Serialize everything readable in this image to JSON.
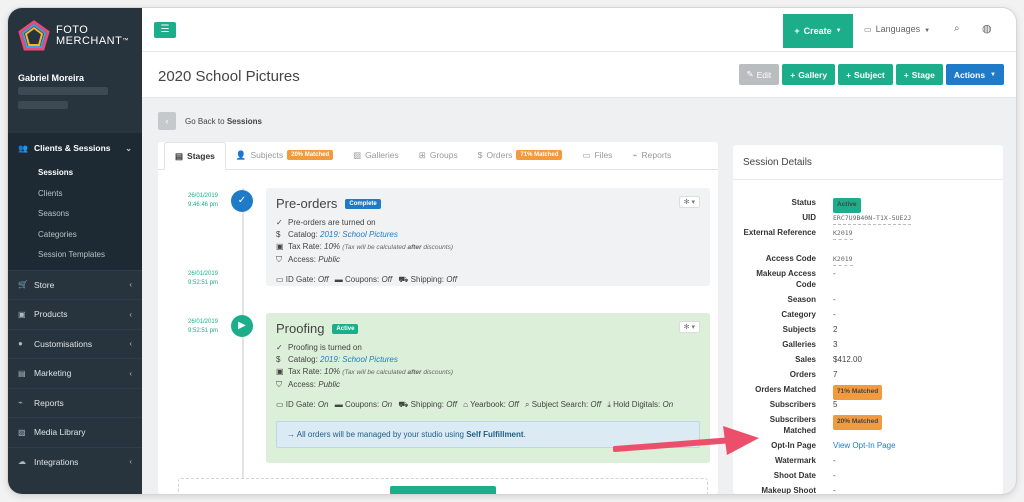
{
  "brand": {
    "name_line1": "FOTO",
    "name_line2": "MERCHANT",
    "trademark": "™"
  },
  "user": {
    "name": "Gabriel Moreira"
  },
  "sidebar": {
    "group": {
      "label": "Clients & Sessions"
    },
    "subitems": [
      {
        "label": "Sessions"
      },
      {
        "label": "Clients"
      },
      {
        "label": "Seasons"
      },
      {
        "label": "Categories"
      },
      {
        "label": "Session Templates"
      }
    ],
    "items": [
      {
        "label": "Store",
        "icon": "cart-icon"
      },
      {
        "label": "Products",
        "icon": "box-icon"
      },
      {
        "label": "Customisations",
        "icon": "palette-icon"
      },
      {
        "label": "Marketing",
        "icon": "megaphone-icon"
      },
      {
        "label": "Reports",
        "icon": "chart-icon"
      },
      {
        "label": "Media Library",
        "icon": "image-icon"
      },
      {
        "label": "Integrations",
        "icon": "cloud-icon"
      }
    ]
  },
  "topbar": {
    "create_label": "Create",
    "languages_label": "Languages"
  },
  "header": {
    "title": "2020 School Pictures",
    "buttons": {
      "edit": "Edit",
      "gallery": "Gallery",
      "subject": "Subject",
      "stage": "Stage",
      "actions": "Actions"
    }
  },
  "back": {
    "prefix": "Go Back to",
    "target": "Sessions"
  },
  "tabs": [
    {
      "label": "Stages"
    },
    {
      "label": "Subjects",
      "badge": "20% Matched"
    },
    {
      "label": "Galleries"
    },
    {
      "label": "Groups"
    },
    {
      "label": "Orders",
      "badge": "71% Matched"
    },
    {
      "label": "Files"
    },
    {
      "label": "Reports"
    }
  ],
  "timeline": {
    "ts1": {
      "date": "26/01/2019",
      "time": "9:46:46 pm"
    },
    "ts2": {
      "date": "26/01/2019",
      "time": "9:52:51 pm"
    },
    "ts3": {
      "date": "26/01/2019",
      "time": "9:52:51 pm"
    }
  },
  "preorders": {
    "title": "Pre-orders",
    "status": "Complete",
    "line1": "Pre-orders are turned on",
    "catalog_label": "Catalog:",
    "catalog_value": "2019: School Pictures",
    "tax_label": "Tax Rate:",
    "tax_value": "10%",
    "tax_note_pre": "(Tax will be calculated",
    "tax_note_bold": "after",
    "tax_note_post": "discounts)",
    "access_label": "Access:",
    "access_value": "Public",
    "idgate_label": "ID Gate:",
    "idgate_value": "Off",
    "coupons_label": "Coupons:",
    "coupons_value": "Off",
    "shipping_label": "Shipping:",
    "shipping_value": "Off"
  },
  "proofing": {
    "title": "Proofing",
    "status": "Active",
    "line1": "Proofing is turned on",
    "catalog_label": "Catalog:",
    "catalog_value": "2019: School Pictures",
    "tax_label": "Tax Rate:",
    "tax_value": "10%",
    "tax_note_pre": "(Tax will be calculated",
    "tax_note_bold": "after",
    "tax_note_post": "discounts)",
    "access_label": "Access:",
    "access_value": "Public",
    "idgate_label": "ID Gate:",
    "idgate_value": "On",
    "coupons_label": "Coupons:",
    "coupons_value": "On",
    "shipping_label": "Shipping:",
    "shipping_value": "Off",
    "yearbook_label": "Yearbook:",
    "yearbook_value": "Off",
    "subjectsearch_label": "Subject Search:",
    "subjectsearch_value": "Off",
    "holddigitals_label": "Hold Digitals:",
    "holddigitals_value": "On",
    "info_pre": "All orders will be managed by your studio using",
    "info_bold": "Self Fulfillment",
    "info_post": "."
  },
  "details": {
    "title": "Session Details",
    "rows": [
      {
        "label": "Status",
        "value": "Active",
        "kind": "badge-green"
      },
      {
        "label": "UID",
        "value": "ERC7U9B40N-T1X-5UE2J",
        "kind": "mono"
      },
      {
        "label": "External Reference",
        "value": "K2019",
        "kind": "mono"
      },
      {
        "label": "Access Code",
        "value": "K2019",
        "kind": "mono"
      },
      {
        "label": "Makeup Access Code",
        "value": "-",
        "kind": "text"
      },
      {
        "label": "Season",
        "value": "-",
        "kind": "text"
      },
      {
        "label": "Category",
        "value": "-",
        "kind": "text"
      },
      {
        "label": "Subjects",
        "value": "2",
        "kind": "text"
      },
      {
        "label": "Galleries",
        "value": "3",
        "kind": "text"
      },
      {
        "label": "Sales",
        "value": "$412.00",
        "kind": "text"
      },
      {
        "label": "Orders",
        "value": "7",
        "kind": "text"
      },
      {
        "label": "Orders Matched",
        "value": "71% Matched",
        "kind": "badge-orange"
      },
      {
        "label": "Subscribers",
        "value": "5",
        "kind": "text"
      },
      {
        "label": "Subscribers Matched",
        "value": "20% Matched",
        "kind": "badge-orange"
      },
      {
        "label": "Opt-In Page",
        "value": "View Opt-In Page",
        "kind": "link"
      },
      {
        "label": "Watermark",
        "value": "-",
        "kind": "text"
      },
      {
        "label": "Shoot Date",
        "value": "-",
        "kind": "text"
      },
      {
        "label": "Makeup Shoot",
        "value": "-",
        "kind": "text"
      }
    ]
  },
  "colors": {
    "accent": "#1cae8a",
    "sidebar": "#27343e",
    "primary": "#1f7bc8",
    "warning": "#f19a3e",
    "arrow": "#ec4f6b"
  }
}
